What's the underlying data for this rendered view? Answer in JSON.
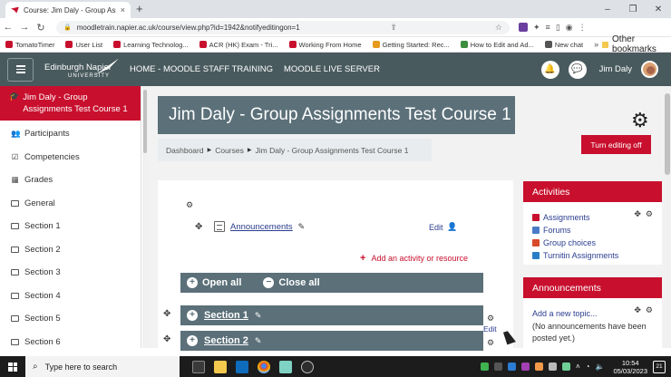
{
  "browser": {
    "tab_title": "Course: Jim Daly - Group Assign",
    "tab_close": "×",
    "new_tab": "+",
    "window_controls": [
      "–",
      "❐",
      "✕"
    ],
    "url": "moodletrain.napier.ac.uk/course/view.php?id=1942&notifyeditingon=1",
    "bookmarks": [
      {
        "label": "TomatoTimer",
        "color": "#c8102e"
      },
      {
        "label": "User List",
        "color": "#c8102e"
      },
      {
        "label": "Learning Technolog...",
        "color": "#c8102e"
      },
      {
        "label": "ACR (HK) Exam - Tri...",
        "color": "#c8102e"
      },
      {
        "label": "Working From Home",
        "color": "#c8102e"
      },
      {
        "label": "Getting Started: Rec...",
        "color": "#e69a1e"
      },
      {
        "label": "How to Edit and Ad...",
        "color": "#3c8d3c"
      },
      {
        "label": "New chat",
        "color": "#555555"
      }
    ],
    "other_bookmarks": "Other bookmarks"
  },
  "navbar": {
    "logo_line1": "Edinburgh Napier",
    "logo_line2": "UNIVERSITY",
    "links": [
      "HOME - MOODLE STAFF TRAINING",
      "MOODLE LIVE SERVER"
    ],
    "user_name": "Jim Daly"
  },
  "drawer": {
    "active": "Jim Daly - Group Assignments Test Course 1",
    "items": [
      {
        "label": "Participants",
        "icon": "users-icon"
      },
      {
        "label": "Competencies",
        "icon": "check-square-icon"
      },
      {
        "label": "Grades",
        "icon": "table-icon"
      },
      {
        "label": "General",
        "icon": "folder-icon"
      },
      {
        "label": "Section 1",
        "icon": "folder-icon"
      },
      {
        "label": "Section 2",
        "icon": "folder-icon"
      },
      {
        "label": "Section 3",
        "icon": "folder-icon"
      },
      {
        "label": "Section 4",
        "icon": "folder-icon"
      },
      {
        "label": "Section 5",
        "icon": "folder-icon"
      },
      {
        "label": "Section 6",
        "icon": "folder-icon"
      }
    ]
  },
  "course": {
    "title": "Jim Daly - Group Assignments Test Course 1",
    "breadcrumb": [
      "Dashboard",
      "Courses",
      "Jim Daly - Group Assignments Test Course 1"
    ],
    "turn_editing": "Turn editing off"
  },
  "main": {
    "announcements_link": "Announcements",
    "edit": "Edit",
    "add_activity": "Add an activity or resource",
    "open_all": "Open all",
    "close_all": "Close all",
    "sections": [
      "Section 1",
      "Section 2"
    ],
    "section_edit": "Edit"
  },
  "blocks": {
    "activities": {
      "title": "Activities",
      "items": [
        {
          "label": "Assignments",
          "color": "#c8102e"
        },
        {
          "label": "Forums",
          "color": "#4a7bc8"
        },
        {
          "label": "Group choices",
          "color": "#d84a2a"
        },
        {
          "label": "Turnitin Assignments",
          "color": "#2a7fc8"
        }
      ]
    },
    "announcements": {
      "title": "Announcements",
      "add_new": "Add a new topic...",
      "none": "(No announcements have been posted yet.)"
    }
  },
  "taskbar": {
    "search_placeholder": "Type here to search",
    "time": "10:54",
    "date": "05/03/2023",
    "notifications": "21"
  }
}
